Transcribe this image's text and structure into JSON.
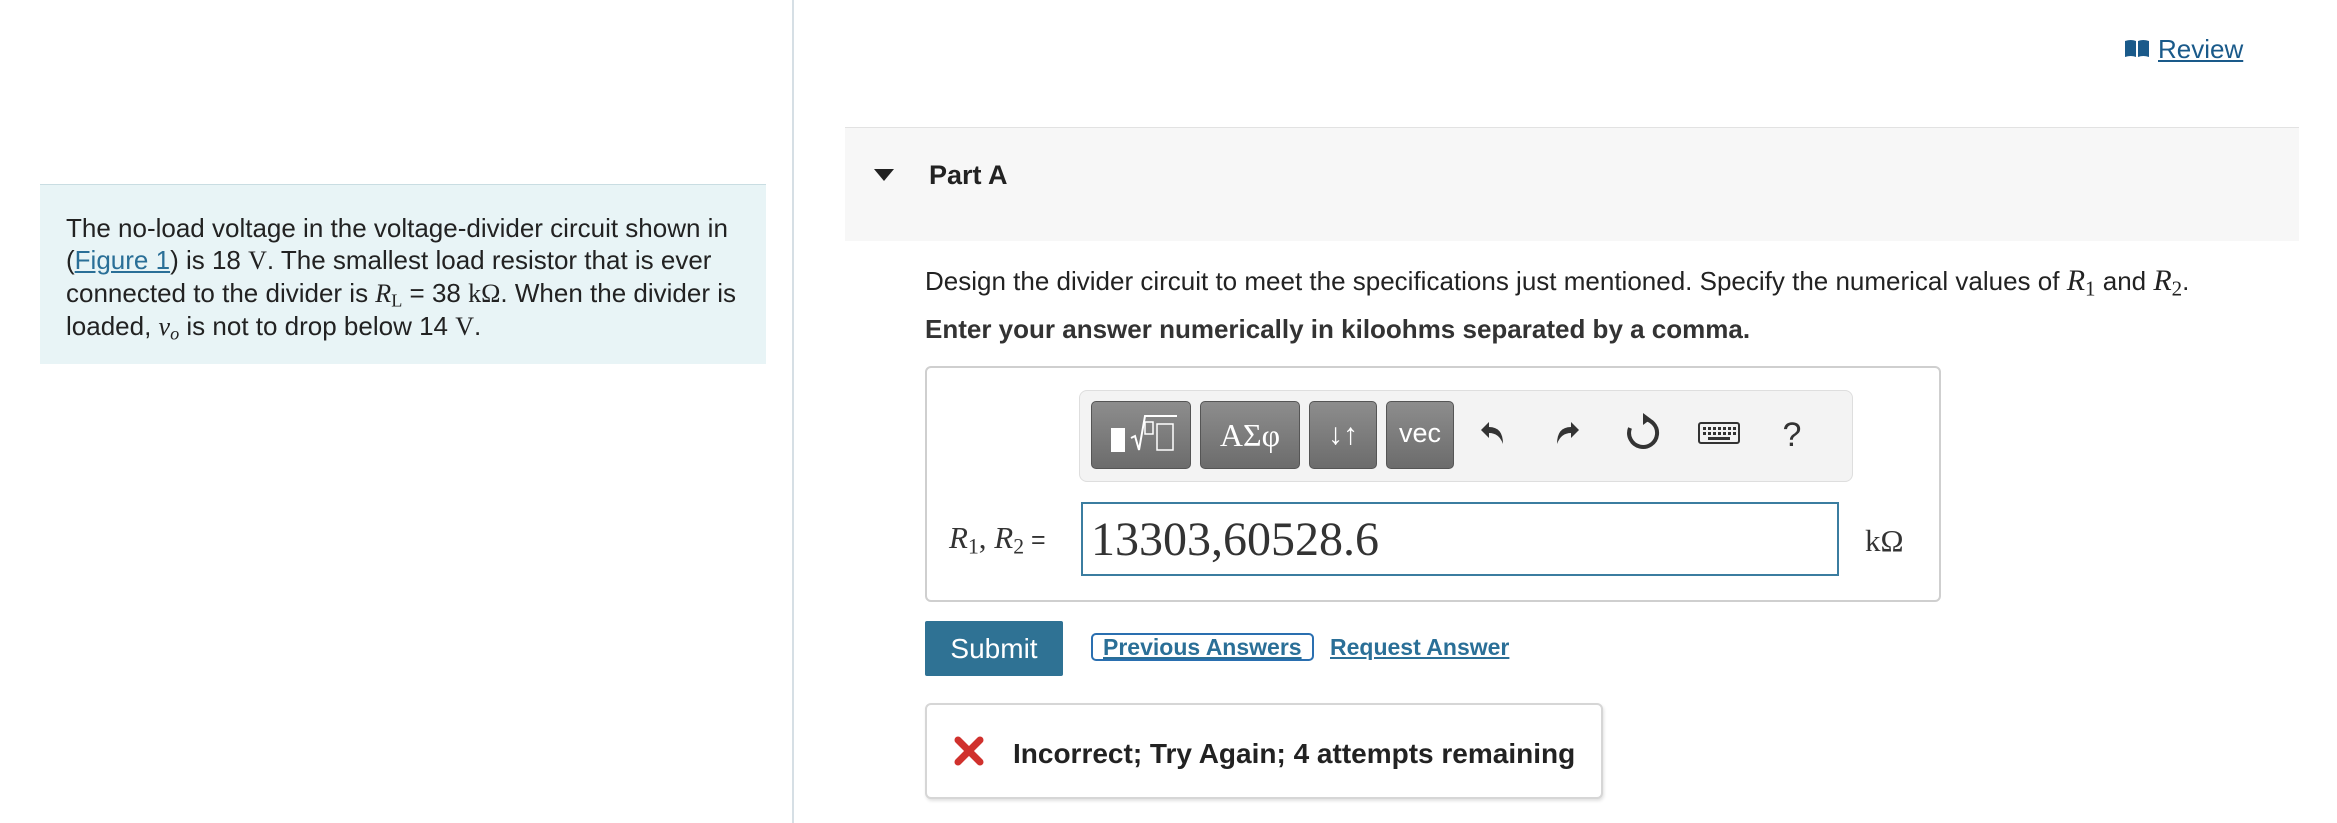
{
  "review": {
    "label": "Review",
    "icon": "book-icon"
  },
  "problem": {
    "text_1": "The no-load voltage in the voltage-divider circuit shown in (",
    "figure_link": "Figure 1",
    "text_2": ") is 18 ",
    "unit_v": "V",
    "text_3": ". The smallest load resistor that is ever connected to the divider is ",
    "rl_symbol": "R",
    "rl_sub": "L",
    "rl_value": " = 38 ",
    "unit_kohm": "kΩ",
    "text_4": ". When the divider is loaded, ",
    "vo_symbol": "v",
    "vo_sub": "o",
    "text_5": " is not to drop below 14 ",
    "unit_v2": "V",
    "text_6": "."
  },
  "part": {
    "title": "Part A",
    "toggle_icon": "caret-down-icon"
  },
  "question": {
    "text_1": "Design the divider circuit to meet the specifications just mentioned. Specify the numerical values of ",
    "r1_symbol": "R",
    "r1_sub": "1",
    "text_2": " and ",
    "r2_symbol": "R",
    "r2_sub": "2",
    "text_3": ".",
    "instruction": "Enter your answer numerically in kiloohms separated by a comma."
  },
  "toolbar": {
    "greek_label": "ΑΣφ",
    "arrows_label": "↓↑",
    "vec_label": "vec",
    "help_label": "?",
    "icons": [
      "templates-icon",
      "greek-letters-icon",
      "subscript-superscript-icon",
      "vector-icon",
      "undo-icon",
      "redo-icon",
      "reset-icon",
      "keyboard-icon",
      "help-icon"
    ]
  },
  "answer": {
    "var1": "R",
    "var1_sub": "1",
    "separator": ", ",
    "var2": "R",
    "var2_sub": "2",
    "equals": " =",
    "value": "13303,60528.6",
    "unit": "kΩ"
  },
  "actions": {
    "submit_label": "Submit",
    "previous_answers_label": "Previous Answers",
    "request_answer_label": "Request Answer"
  },
  "feedback": {
    "text": "Incorrect; Try Again; 4 attempts remaining",
    "icon": "x-mark-icon",
    "icon_color": "#d0312d"
  },
  "colors": {
    "accent": "#2f7294",
    "link": "#2a6f97",
    "problem_bg": "#e8f4f6",
    "error": "#d0312d"
  }
}
